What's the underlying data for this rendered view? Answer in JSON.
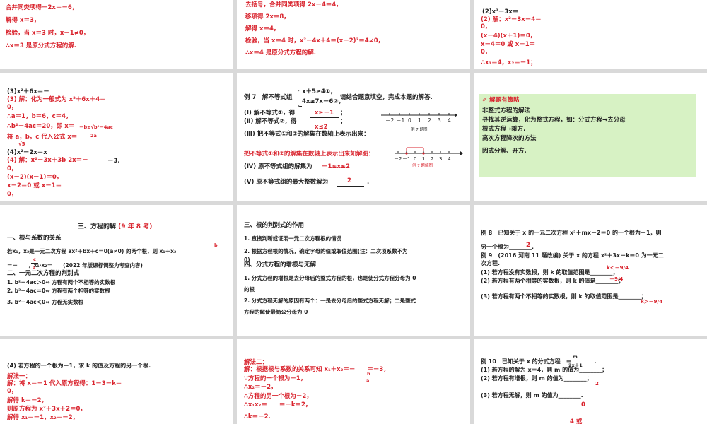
{
  "s1": [
    "合并同类项得－2x＝－6，",
    "解得 x＝3，",
    "检验，当 x＝3 时，x－1≠0，",
    "∴x＝3 是原分式方程的解."
  ],
  "s2": [
    "去括号，合并同类项得 2x－4＝4，",
    "移项得 2x＝8，",
    "解得 x＝4，",
    "检验，当 x＝4 时，x²－4x＋4＝(x－2)²＝4≠0，",
    "∴x＝4 是原分式方程的解."
  ],
  "s3": {
    "q": "(2)x²－3x＝",
    "red": [
      "(2) 解：x²－3x－4＝",
      "0，",
      "(x－4)(x＋1)＝0，",
      "x－4＝0 或 x＋1＝",
      "0，",
      "∴x₁＝4，x₂＝－1；"
    ]
  },
  "s4": {
    "q1": "(3)x²＋6x＝－",
    "red1": [
      "(3) 解：化为一般式为 x²＋6x＋4＝",
      "0，",
      "∴a＝1，b＝6，c＝4，",
      "∴b²－4ac＝20，即 x＝",
      "将 a，b，c 代入公式 x＝"
    ],
    "q2": "(4)x²－2x＝x",
    "red2": [
      "(4) 解：x²－3x＋3b 2x＝－",
      "0，",
      "(x－2)(x－1)＝0，",
      "x－2＝0 或 x－1＝",
      "0，"
    ],
    "tail": "－3.",
    "frac": [
      "－b±√b²－4ac",
      "2a",
      "√5"
    ]
  },
  "s5": {
    "title": "例 7　解不等式组",
    "sys": [
      "x＋5≥4①，",
      "4x≥7x－6②，"
    ],
    "after": "请结合题意填空，完成本题的解答.",
    "items": [
      "(Ⅰ) 解不等式①，得",
      "(Ⅱ) 解不等式②，得",
      "(Ⅲ) 把不等式①和②的解集在数轴上表示出来：",
      "(Ⅳ) 原不等式组的解集为",
      "(Ⅴ) 原不等式组的最大整数解为"
    ],
    "ans": [
      "x≥－1",
      "x≤2",
      "－1≤x≤2",
      "2"
    ],
    "red_line": "把不等式①和②的解集在数轴上表示出来如解图：",
    "ticks": [
      "－2",
      "－1",
      "0",
      "1",
      "2",
      "3",
      "4"
    ],
    "fig1": "例 7 题图",
    "fig2": "例 7 题解图",
    "semi": "；",
    "period": "."
  },
  "s6": {
    "title": "解题有策略",
    "lines": [
      "非整式方程的解法",
      "寻找其逆运算，化为整式方程，如：分式方程→去分母",
      "根式方程→乘方.",
      "高次方程降次的方法",
      "因式分解、开方."
    ]
  },
  "s7": {
    "title": "三、方程的解",
    "title_red": "(9 年 8 考)",
    "lines": [
      "一、根与系数的关系",
      "若x₁，x₂是一元二次方程 ax²＋bx＋c＝0(a≠0) 的两个根，则 x₁＋x₂",
      "＝－　　，x₁·x₂＝　　(2022 年版课标调整为考查内容)",
      "二、一元二次方程的判别式",
      "1.  b²－4ac＞0⇔ 方程有两个不相等的实数根",
      "2.  b²－4ac＝0⇔ 方程有两个相等的实数根",
      "3.  b²－4ac＜0⇔ 方程无实数根"
    ],
    "fr": [
      "b",
      "a",
      "c",
      "a"
    ]
  },
  "s8": {
    "lines": [
      "三、根的判别式的作用",
      "1.  直接判断或证明一元二次方程根的情况",
      "2. 根据方程根的情况，确定字母的值或取值范围(注：二次项系数不为",
      "0)",
      "四、分式方程的增根与无解",
      "1.  分式方程的增根是去分母后的整式方程的根，也是使分式方程分母为 0",
      "的根",
      "2. 分式方程无解的原因有两个：一是去分母后的整式方程无解；二是整式",
      "方程的解使最简公分母为 0"
    ]
  },
  "s9": {
    "lines": [
      "例 8　已知关于 x 的一元二次方程 x²＋mx－2＝0 的一个根为－1，则",
      "另一个根为________.",
      "例 9　(2016 河南 11 题改编) 关于 x 的方程 x²＋3x－k＝0 为一元二",
      "次方程.",
      "(1) 若方程没有实数根，则 k 的取值范围是________；",
      "(2) 若方程有两个相等的实数根，则 k 的值是________；",
      "(3) 若方程有两个不相等的实数根，则 k 的取值范围是________；"
    ],
    "ans": [
      "2",
      "k＜－9/4",
      "－9/4",
      "k＞－9/4"
    ]
  },
  "s10": {
    "q": "(4) 若方程的一个根为－1，求 k 的值及方程的另一个根.",
    "red": [
      "解法一：",
      "解：将 x＝－1 代入原方程得：1－3－k＝",
      "0，",
      "解得 k＝－2，",
      "则原方程为 x²＋3x＋2＝0，",
      "解得 x₁＝－1，x₂＝－2，"
    ]
  },
  "s11": {
    "red": [
      "解法二：",
      "解：根据根与系数的关系可知 x₁＋x₂＝－　　＝－3，",
      "∵方程的一个根为－1，",
      "∴x₂＝－2，",
      "∴方程的另一个根为－2，",
      "∴x₁x₂＝　　＝－k＝2，",
      "∴k＝－2."
    ],
    "fr": [
      "b",
      "a",
      "c",
      "a"
    ]
  },
  "s12": {
    "title": "例 10　已知关于 x 的分式方程　＝　　　　.",
    "lines": [
      "(1) 若方程的解为 x＝4，则 m 的值为________；",
      "(2) 若方程有增根，则 m 的值为________；",
      "(3) 若方程无解，则 m 的值为________."
    ],
    "ans": [
      "2",
      "0",
      "4 或"
    ],
    "fr": [
      "m",
      "2x＋1"
    ]
  }
}
